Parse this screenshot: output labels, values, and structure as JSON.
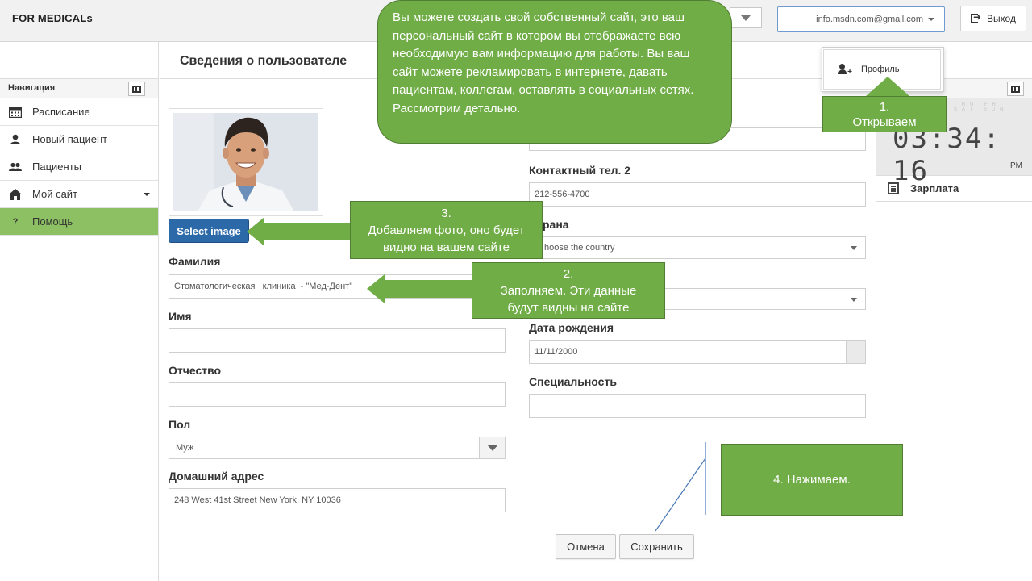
{
  "app": {
    "brand": "FOR MEDICALs"
  },
  "header": {
    "user_email": "info.msdn.com@gmail.com",
    "logout_label": "Выход"
  },
  "page": {
    "title": "Сведения о пользователе"
  },
  "sidebar": {
    "header": "Навигация",
    "items": [
      {
        "label": "Расписание",
        "icon": "calendar-icon"
      },
      {
        "label": "Новый пациент",
        "icon": "user-icon"
      },
      {
        "label": "Пациенты",
        "icon": "users-icon"
      },
      {
        "label": "Мой сайт",
        "icon": "home-icon"
      },
      {
        "label": "Помощь",
        "icon": "question-icon",
        "active": true
      }
    ]
  },
  "right_panel": {
    "clock_days": "THU FRI SAT SUN",
    "clock_time": "03:34: 16",
    "clock_ampm": "PM",
    "salary_label": "Зарплата"
  },
  "profile_menu": {
    "profile_label": "Профиль"
  },
  "form": {
    "select_image_label": "Select image",
    "last_name_label": "Фамилия",
    "last_name_value": "Стоматологическая   клиника  - \"Мед-Дент\"",
    "first_name_label": "Имя",
    "first_name_value": "",
    "patronymic_label": "Отчество",
    "patronymic_value": "",
    "gender_label": "Пол",
    "gender_value": "Муж",
    "address_label": "Домашний адрес",
    "address_value": "248 West 41st Street New York, NY 10036",
    "phone2_label": "Контактный тел. 2",
    "phone2_value": "212-556-4700",
    "country_label": "рана",
    "country_value": "hoose the country",
    "birth_label": "Дата рождения",
    "birth_value": "11/11/2000",
    "specialty_label": "Специальность",
    "specialty_value": "",
    "cancel_label": "Отмена",
    "save_label": "Сохранить"
  },
  "annotations": {
    "bubble": "Вы можете создать свой собственный сайт, это ваш персональный сайт в котором вы отображаете всю необходимую вам информацию для работы. Вы ваш сайт можете рекламировать в интернете, давать пациентам, коллегам, оставлять в социальных сетях.  Рассмотрим детально.",
    "step1_line1": "1.",
    "step1_line2": "Открываем",
    "step2_line1": "2.",
    "step2_line2": "Заполняем. Эти данные",
    "step2_line3": "будут видны на сайте",
    "step3_line1": "3.",
    "step3_line2": "Добавляем фото, оно будет",
    "step3_line3": "видно на вашем сайте",
    "step4": "4. Нажимаем."
  },
  "colors": {
    "callout_green": "#70ad47",
    "active_nav": "#8dc063",
    "primary_button": "#2b69a8"
  }
}
